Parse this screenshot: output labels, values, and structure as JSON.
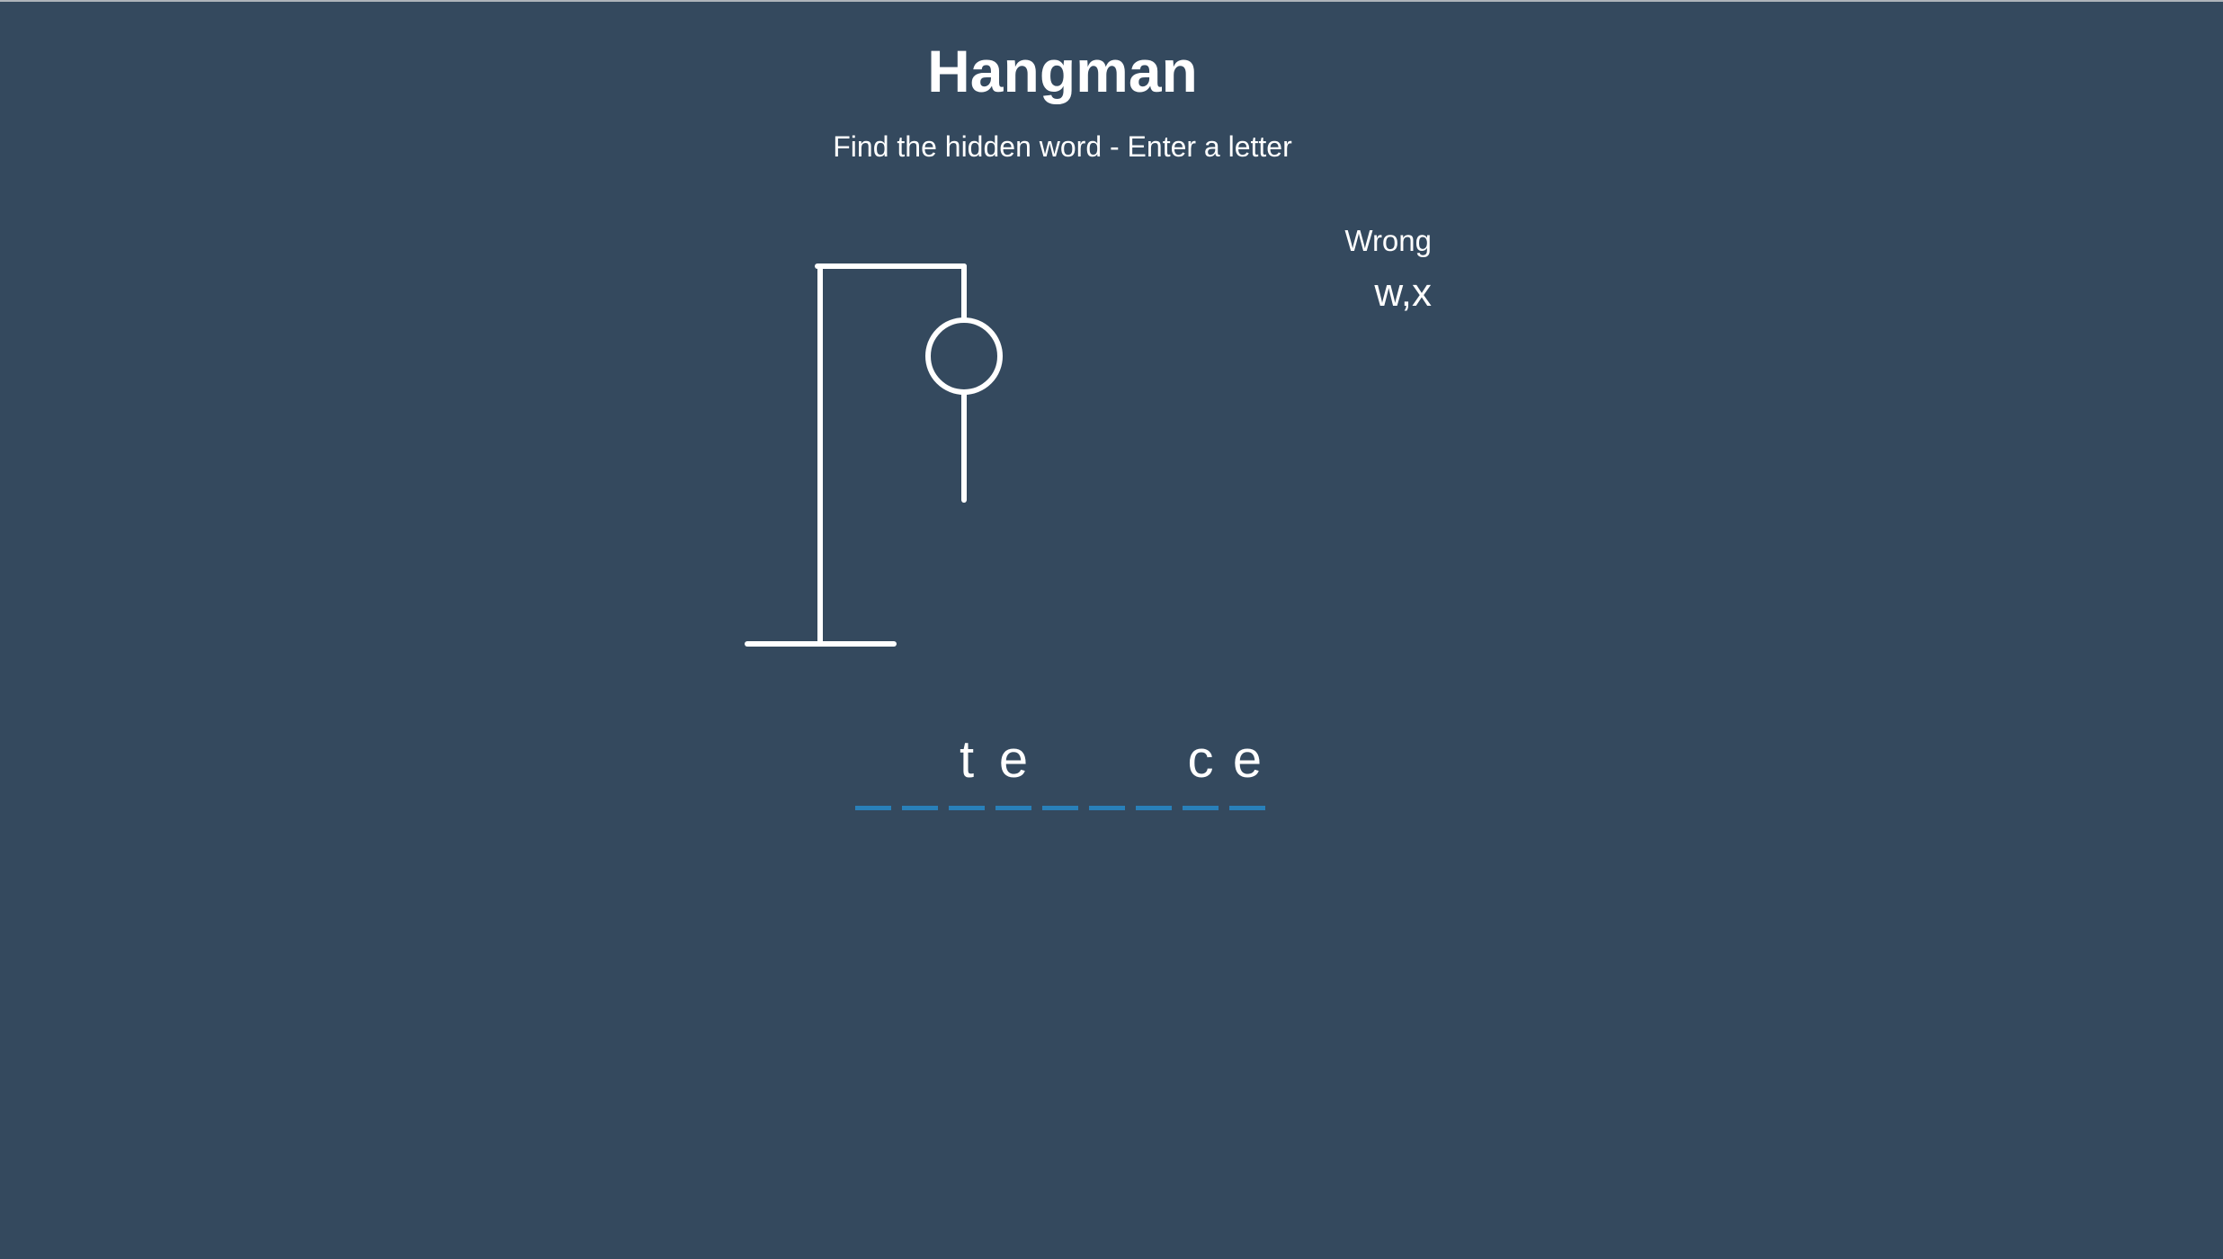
{
  "game": {
    "title": "Hangman",
    "subtitle": "Find the hidden word - Enter a letter"
  },
  "wrong": {
    "label": "Wrong",
    "letters": "w,x"
  },
  "word": {
    "letters": [
      "",
      "",
      "t",
      "e",
      "",
      "",
      "",
      "c",
      "e"
    ]
  },
  "figure": {
    "parts_shown": [
      "head",
      "body"
    ]
  },
  "colors": {
    "background": "#34495e",
    "text": "#ffffff",
    "slot_underline": "#2980b9"
  }
}
